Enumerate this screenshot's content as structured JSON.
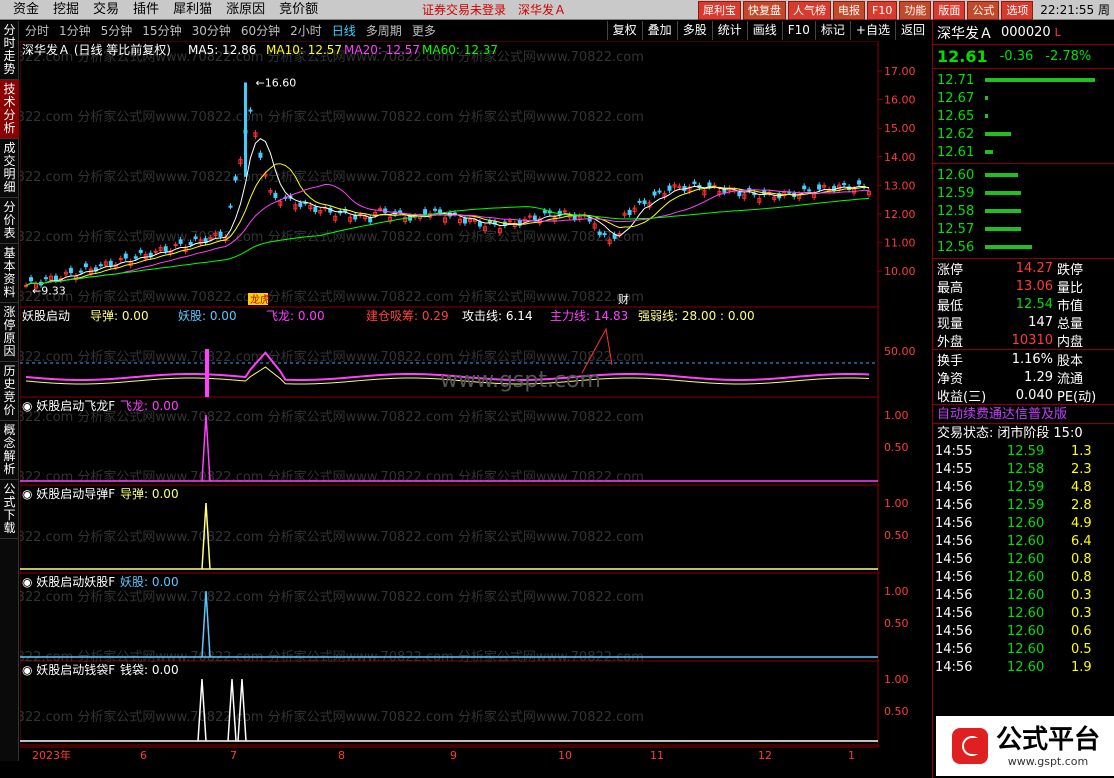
{
  "menu": [
    "资金",
    "挖掘",
    "交易",
    "插件",
    "犀利猫",
    "涨原因",
    "竞价额"
  ],
  "notice": {
    "text": "证券交易未登录",
    "stock": "深华发Ａ"
  },
  "quick_buttons": [
    "犀利宝",
    "快复盘",
    "人气榜",
    "电报",
    "F10",
    "功能",
    "版面",
    "公式",
    "选项"
  ],
  "clock": "22:21:55 周",
  "periods": [
    "分时",
    "1分钟",
    "5分钟",
    "15分钟",
    "30分钟",
    "60分钟",
    "2小时",
    "日线",
    "多周期",
    "更多"
  ],
  "selected_period": "日线",
  "tools": [
    "复权",
    "叠加",
    "多股",
    "统计",
    "画线",
    "F10",
    "标记",
    "+自选",
    "返回"
  ],
  "side_tabs": [
    "分时走势",
    "技术分析",
    "成交明细",
    "分价表",
    "基本资料",
    "涨停原因",
    "历史竞价",
    "概念解析",
    "公式下载"
  ],
  "main_chart": {
    "title": "深华发Ａ (日线 等比前复权)",
    "ma": [
      {
        "label": "MA5: 12.86",
        "color": "#ffffff"
      },
      {
        "label": "MA10: 12.57",
        "color": "#ffff00"
      },
      {
        "label": "MA20: 12.57",
        "color": "#ff40ff"
      },
      {
        "label": "MA60: 12.37",
        "color": "#00ff00"
      }
    ],
    "high_label": "16.60",
    "low_label": "9.33",
    "yticks": [
      "17.00",
      "16.00",
      "15.00",
      "14.00",
      "13.00",
      "12.00",
      "11.00",
      "10.00"
    ],
    "markers": [
      "龙虎",
      "财"
    ],
    "watermark": "70822.com 分析家公式网www.70822.com 分析家公式网www.70822.com 分析家公式网www.70822.com"
  },
  "sub1": {
    "title": "妖股启动",
    "items": [
      {
        "label": "导弹: 0.00",
        "color": "#ffff80"
      },
      {
        "label": "妖股: 0.00",
        "color": "#5ac8ff"
      },
      {
        "label": "飞龙: 0.00",
        "color": "#ff40ff"
      },
      {
        "label": "建仓吸筹: 0.29",
        "color": "#ff4040"
      },
      {
        "label": "攻击线: 6.14",
        "color": "#ffffff"
      },
      {
        "label": "主力线: 14.83",
        "color": "#ff40ff"
      },
      {
        "label": "强弱线: 28.00 : 0.00",
        "color": "#ffff80"
      }
    ],
    "ytick": "50.00",
    "watermark2": "www.gspt.com"
  },
  "sub2": {
    "title": "妖股启动飞龙F",
    "value": "飞龙: 0.00",
    "color": "#ff40ff",
    "yticks": [
      "1.00",
      "0.50"
    ]
  },
  "sub3": {
    "title": "妖股启动导弹F",
    "value": "导弹: 0.00",
    "color": "#ffff80",
    "yticks": [
      "1.00",
      "0.50"
    ]
  },
  "sub4": {
    "title": "妖股启动妖股F",
    "value": "妖股: 0.00",
    "color": "#5ac8ff",
    "yticks": [
      "1.00",
      "0.50"
    ]
  },
  "sub5": {
    "title": "妖股启动钱袋F",
    "value": "钱袋: 0.00",
    "color": "#ffffff",
    "yticks": [
      "1.00",
      "0.50"
    ]
  },
  "xaxis": [
    "2023年",
    "6",
    "7",
    "8",
    "9",
    "10",
    "11",
    "12",
    "1"
  ],
  "right": {
    "name": "深华发Ａ",
    "code": "000020",
    "flag": "L",
    "price": "12.61",
    "change": "-0.36",
    "pct": "-2.78%",
    "asks": [
      {
        "price": "12.71",
        "bar": 1.0
      },
      {
        "price": "12.67",
        "bar": 0.03
      },
      {
        "price": "12.65",
        "bar": 0.03
      },
      {
        "price": "12.62",
        "bar": 0.24
      },
      {
        "price": "12.61",
        "bar": 0.07
      }
    ],
    "bids": [
      {
        "price": "12.60",
        "bar": 0.3
      },
      {
        "price": "12.59",
        "bar": 0.33
      },
      {
        "price": "12.58",
        "bar": 0.33
      },
      {
        "price": "12.57",
        "bar": 0.33
      },
      {
        "price": "12.56",
        "bar": 0.43
      }
    ],
    "stats": [
      {
        "l": "涨停",
        "v": "14.27",
        "vc": "red",
        "r": "跌停"
      },
      {
        "l": "最高",
        "v": "13.06",
        "vc": "red",
        "r": "量比"
      },
      {
        "l": "最低",
        "v": "12.54",
        "vc": "green",
        "r": "市值"
      },
      {
        "l": "现量",
        "v": "147",
        "vc": "white",
        "r": "总量"
      },
      {
        "l": "外盘",
        "v": "10310",
        "vc": "red",
        "r": "内盘"
      }
    ],
    "stats2": [
      {
        "l": "换手",
        "v": "1.16%",
        "r": "股本"
      },
      {
        "l": "净资",
        "v": "1.29",
        "r": "流通"
      },
      {
        "l": "收益(三)",
        "v": "0.040",
        "r": "PE(动)"
      }
    ],
    "renew": "自动续费通达信普及版",
    "status_label": "交易状态:",
    "status": "闭市阶段",
    "status_time": "15:0",
    "ticks": [
      {
        "t": "14:55",
        "p": "12.59",
        "v": "1.3"
      },
      {
        "t": "14:55",
        "p": "12.58",
        "v": "2.3"
      },
      {
        "t": "14:56",
        "p": "12.59",
        "v": "4.8"
      },
      {
        "t": "14:56",
        "p": "12.59",
        "v": "2.8"
      },
      {
        "t": "14:56",
        "p": "12.60",
        "v": "4.9"
      },
      {
        "t": "14:56",
        "p": "12.60",
        "v": "6.4"
      },
      {
        "t": "14:56",
        "p": "12.60",
        "v": "0.8"
      },
      {
        "t": "14:56",
        "p": "12.60",
        "v": "0.8"
      },
      {
        "t": "14:56",
        "p": "12.60",
        "v": "0.3"
      },
      {
        "t": "14:56",
        "p": "12.60",
        "v": "0.3"
      },
      {
        "t": "14:56",
        "p": "12.60",
        "v": "0.6"
      },
      {
        "t": "14:56",
        "p": "12.60",
        "v": "0.5"
      },
      {
        "t": "14:56",
        "p": "12.60",
        "v": "1.9"
      }
    ]
  },
  "logo": {
    "text": "公式平台",
    "url": "www.gspt.com"
  }
}
